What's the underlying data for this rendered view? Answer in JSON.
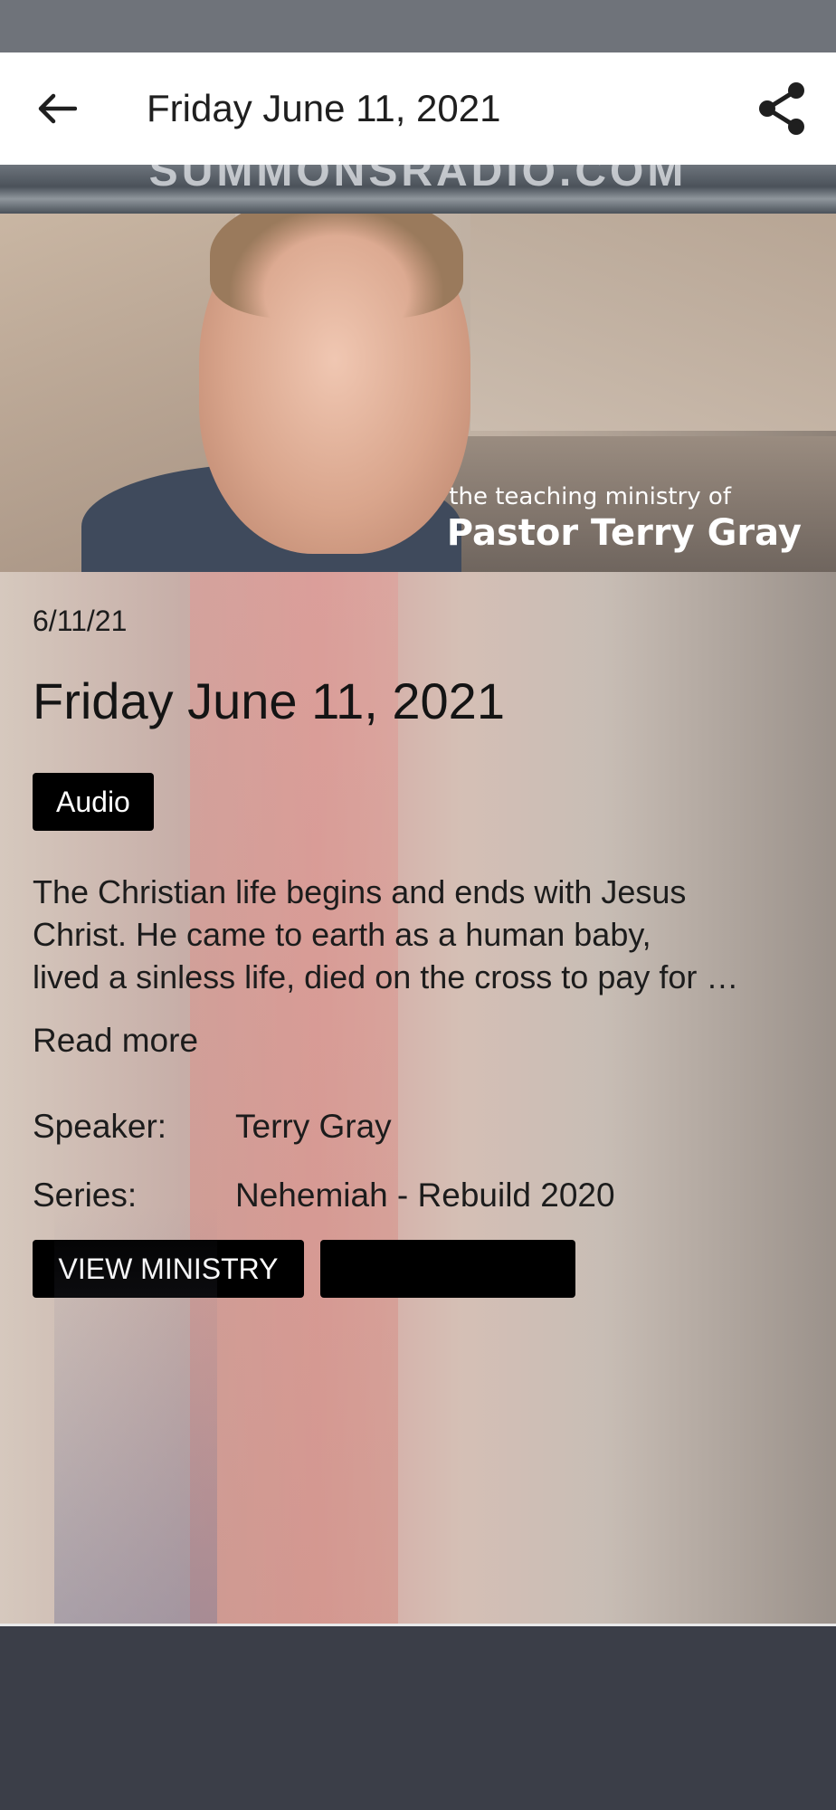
{
  "app_bar": {
    "title": "Friday June 11, 2021",
    "back_icon": "arrow-left-icon",
    "share_icon": "share-icon"
  },
  "hero": {
    "banner_text": "SUMMONSRADIO.COM",
    "caption_small": "the teaching ministry of",
    "caption_large": "Pastor Terry Gray"
  },
  "sermon": {
    "date": "6/11/21",
    "title": "Friday June 11, 2021",
    "media_type": "Audio",
    "description_lines": [
      "The Christian life begins and ends with Jesus",
      "Christ. He came to earth as a human baby,",
      "lived a sinless life, died on the cross to pay for …"
    ],
    "read_more": "Read more",
    "speaker_label": "Speaker:",
    "speaker_value": "Terry Gray",
    "series_label": "Series:",
    "series_value": "Nehemiah - Rebuild 2020"
  },
  "actions": {
    "view_ministry": "VIEW MINISTRY",
    "second_button": ""
  }
}
